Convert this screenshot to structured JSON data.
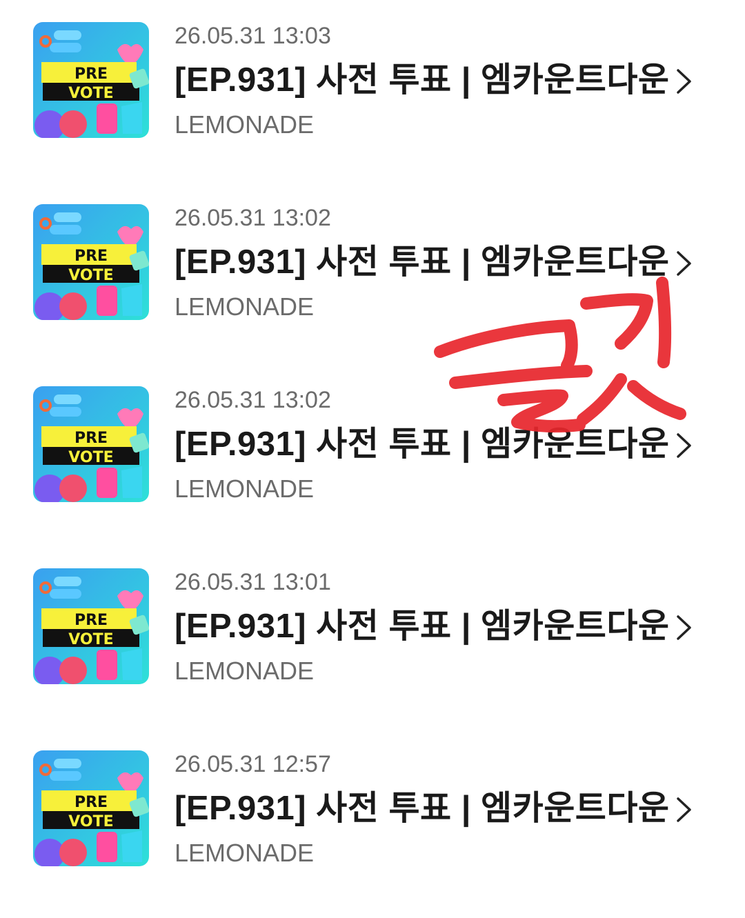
{
  "items": [
    {
      "date": "26.05.31 13:03",
      "title": "[EP.931] 사전 투표 | 엠카운트다운",
      "artist": "LEMONADE",
      "thumb_text_1": "PRE",
      "thumb_text_2": "VOTE"
    },
    {
      "date": "26.05.31 13:02",
      "title": "[EP.931] 사전 투표 | 엠카운트다운",
      "artist": "LEMONADE",
      "thumb_text_1": "PRE",
      "thumb_text_2": "VOTE"
    },
    {
      "date": "26.05.31 13:02",
      "title": "[EP.931] 사전 투표 | 엠카운트다운",
      "artist": "LEMONADE",
      "thumb_text_1": "PRE",
      "thumb_text_2": "VOTE"
    },
    {
      "date": "26.05.31 13:01",
      "title": "[EP.931] 사전 투표 | 엠카운트다운",
      "artist": "LEMONADE",
      "thumb_text_1": "PRE",
      "thumb_text_2": "VOTE"
    },
    {
      "date": "26.05.31 12:57",
      "title": "[EP.931] 사전 투표 | 엠카운트다운",
      "artist": "LEMONADE",
      "thumb_text_1": "PRE",
      "thumb_text_2": "VOTE"
    }
  ],
  "colors": {
    "date": "#6b6b6b",
    "title": "#1a1a1a",
    "artist": "#6b6b6b",
    "chevron": "#222222",
    "scribble": "#e8262c",
    "thumb_bg": "#2fc4e8",
    "thumb_banner": "#f7f03a"
  },
  "icons": {
    "row_action": "chevron-right-icon",
    "thumbnail": "pre-vote-thumbnail"
  }
}
